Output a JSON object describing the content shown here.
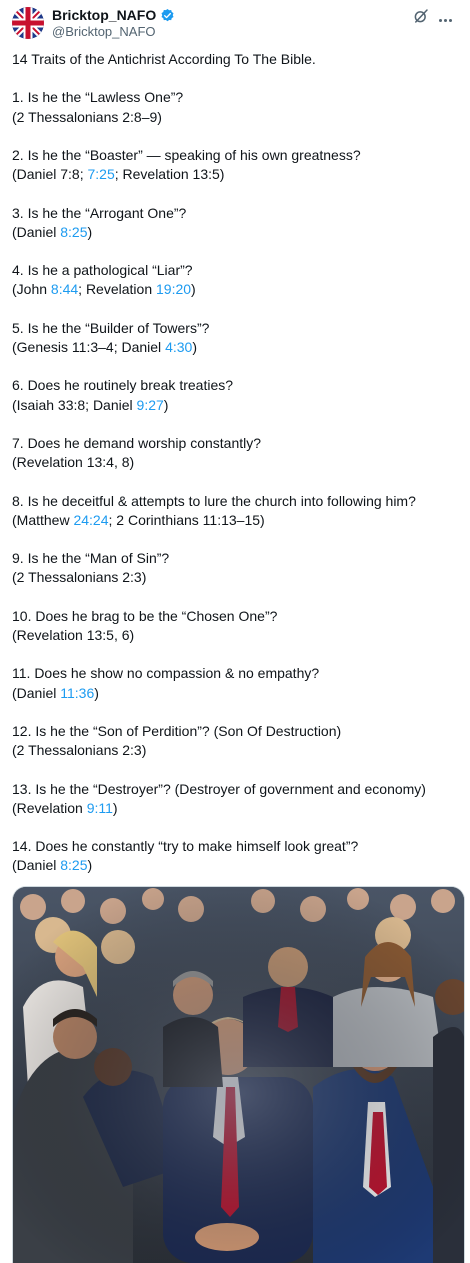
{
  "author": {
    "display_name": "Bricktop_NAFO",
    "handle": "@Bricktop_NAFO",
    "verified_color": "#1d9bf0"
  },
  "icons": {
    "grok": "grok-icon",
    "more": "more-icon",
    "verified": "verified-badge-icon"
  },
  "post": {
    "title": "14 Traits of the Antichrist According To The Bible.",
    "items": [
      {
        "q": "1. Is he the “Lawless One”?",
        "ref": [
          {
            "t": "(2 Thessalonians 2:8–9)"
          }
        ]
      },
      {
        "q": "2. Is he the “Boaster” — speaking of his own greatness?",
        "ref": [
          {
            "t": "(Daniel 7:8; "
          },
          {
            "t": "7:25",
            "link": true
          },
          {
            "t": "; Revelation 13:5)"
          }
        ]
      },
      {
        "q": "3. Is he the “Arrogant One”?",
        "ref": [
          {
            "t": "(Daniel "
          },
          {
            "t": "8:25",
            "link": true
          },
          {
            "t": ")"
          }
        ]
      },
      {
        "q": "4. Is he a pathological “Liar”?",
        "ref": [
          {
            "t": "(John "
          },
          {
            "t": "8:44",
            "link": true
          },
          {
            "t": "; Revelation "
          },
          {
            "t": "19:20",
            "link": true
          },
          {
            "t": ")"
          }
        ]
      },
      {
        "q": "5. Is he the “Builder of Towers”?",
        "ref": [
          {
            "t": "(Genesis 11:3–4; Daniel "
          },
          {
            "t": "4:30",
            "link": true
          },
          {
            "t": ")"
          }
        ]
      },
      {
        "q": "6. Does he routinely break treaties?",
        "ref": [
          {
            "t": "(Isaiah 33:8; Daniel "
          },
          {
            "t": "9:27",
            "link": true
          },
          {
            "t": ")"
          }
        ]
      },
      {
        "q": "7. Does he demand worship constantly?",
        "ref": [
          {
            "t": "(Revelation 13:4, 8)"
          }
        ]
      },
      {
        "q": "8. Is he deceitful & attempts to lure the church into following him?",
        "ref": [
          {
            "t": "(Matthew "
          },
          {
            "t": "24:24",
            "link": true
          },
          {
            "t": "; 2 Corinthians 11:13–15)"
          }
        ]
      },
      {
        "q": "9. Is he the “Man of Sin”?",
        "ref": [
          {
            "t": "(2 Thessalonians 2:3)"
          }
        ]
      },
      {
        "q": "10. Does he brag to be the “Chosen One”?",
        "ref": [
          {
            "t": "(Revelation 13:5, 6)"
          }
        ]
      },
      {
        "q": "11. Does he show no compassion & no empathy?",
        "ref": [
          {
            "t": "(Daniel "
          },
          {
            "t": "11:36",
            "link": true
          },
          {
            "t": ")"
          }
        ]
      },
      {
        "q": "12. Is he the “Son of Perdition”? (Son Of Destruction)",
        "ref": [
          {
            "t": "(2 Thessalonians 2:3)"
          }
        ]
      },
      {
        "q": "13. Is he the “Destroyer”? (Destroyer of government and economy)",
        "ref": [
          {
            "t": "(Revelation "
          },
          {
            "t": "9:11",
            "link": true
          },
          {
            "t": ")"
          }
        ]
      },
      {
        "q": "14. Does he constantly “try to make himself look great”?",
        "ref": [
          {
            "t": "(Daniel "
          },
          {
            "t": "8:25",
            "link": true
          },
          {
            "t": ")"
          }
        ]
      }
    ]
  },
  "colors": {
    "text": "#0f1419",
    "secondary": "#536471",
    "link": "#1d9bf0"
  }
}
